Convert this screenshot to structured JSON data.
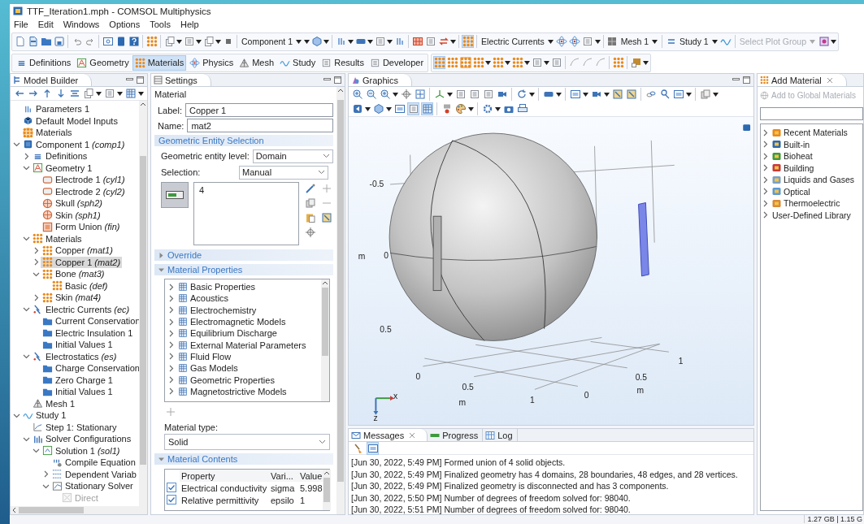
{
  "window": {
    "title": "TTF_Iteration1.mph - COMSOL Multiphysics"
  },
  "menu": [
    "File",
    "Edit",
    "Windows",
    "Options",
    "Tools",
    "Help"
  ],
  "toolbar": {
    "dropdowns": [
      {
        "label": "Component 1",
        "disabled": false
      },
      {
        "label": "Electric Currents",
        "disabled": false
      },
      {
        "label": "Mesh 1",
        "disabled": false
      },
      {
        "label": "Study 1",
        "disabled": false
      },
      {
        "label": "Select Plot Group",
        "disabled": true
      }
    ]
  },
  "ribbon_tabs": [
    {
      "label": "Definitions",
      "selected": false
    },
    {
      "label": "Geometry",
      "selected": false
    },
    {
      "label": "Materials",
      "selected": true
    },
    {
      "label": "Physics",
      "selected": false
    },
    {
      "label": "Mesh",
      "selected": false
    },
    {
      "label": "Study",
      "selected": false
    },
    {
      "label": "Results",
      "selected": false
    },
    {
      "label": "Developer",
      "selected": false
    }
  ],
  "model_builder": {
    "title": "Model Builder",
    "tree": [
      {
        "label": "Parameters 1",
        "kind": "parameter",
        "selected": false,
        "disabled": false
      },
      {
        "label": "Default Model Inputs",
        "kind": "inputs",
        "selected": false,
        "disabled": false
      },
      {
        "label": "Materials",
        "kind": "material-global",
        "selected": false,
        "disabled": false
      },
      {
        "label": "Component 1",
        "tag": "(comp1)",
        "kind": "component",
        "expanded": true,
        "selected": false,
        "disabled": false,
        "children": [
          {
            "label": "Definitions",
            "kind": "definitions",
            "expanded": false,
            "selected": false,
            "disabled": false
          },
          {
            "label": "Geometry 1",
            "kind": "geometry",
            "expanded": true,
            "selected": false,
            "disabled": false,
            "children": [
              {
                "label": "Electrode 1",
                "tag": "(cyl1)",
                "kind": "cylinder",
                "selected": false,
                "disabled": false
              },
              {
                "label": "Electrode 2",
                "tag": "(cyl2)",
                "kind": "cylinder",
                "selected": false,
                "disabled": false
              },
              {
                "label": "Skull",
                "tag": "(sph2)",
                "kind": "sphere",
                "selected": false,
                "disabled": false
              },
              {
                "label": "Skin",
                "tag": "(sph1)",
                "kind": "sphere",
                "selected": false,
                "disabled": false
              },
              {
                "label": "Form Union",
                "tag": "(fin)",
                "kind": "union",
                "selected": false,
                "disabled": false
              }
            ]
          },
          {
            "label": "Materials",
            "kind": "material",
            "expanded": true,
            "selected": false,
            "disabled": false,
            "children": [
              {
                "label": "Copper",
                "tag": "(mat1)",
                "kind": "material",
                "expanded": false,
                "selected": false,
                "disabled": false
              },
              {
                "label": "Copper 1",
                "tag": "(mat2)",
                "kind": "material",
                "expanded": false,
                "selected": true,
                "disabled": false
              },
              {
                "label": "Bone",
                "tag": "(mat3)",
                "kind": "material",
                "expanded": true,
                "selected": false,
                "disabled": false,
                "children": [
                  {
                    "label": "Basic",
                    "tag": "(def)",
                    "kind": "material",
                    "selected": false,
                    "disabled": false
                  }
                ]
              },
              {
                "label": "Skin",
                "tag": "(mat4)",
                "kind": "material",
                "expanded": false,
                "selected": false,
                "disabled": false
              }
            ]
          },
          {
            "label": "Electric Currents",
            "tag": "(ec)",
            "kind": "physics",
            "expanded": true,
            "selected": false,
            "disabled": false,
            "children": [
              {
                "label": "Current Conservation",
                "kind": "feature",
                "selected": false,
                "disabled": false
              },
              {
                "label": "Electric Insulation 1",
                "kind": "feature",
                "selected": false,
                "disabled": false
              },
              {
                "label": "Initial Values 1",
                "kind": "feature",
                "selected": false,
                "disabled": false
              }
            ]
          },
          {
            "label": "Electrostatics",
            "tag": "(es)",
            "kind": "physics",
            "expanded": true,
            "selected": false,
            "disabled": false,
            "children": [
              {
                "label": "Charge Conservation",
                "kind": "feature",
                "selected": false,
                "disabled": false
              },
              {
                "label": "Zero Charge 1",
                "kind": "feature",
                "selected": false,
                "disabled": false
              },
              {
                "label": "Initial Values 1",
                "kind": "feature",
                "selected": false,
                "disabled": false
              }
            ]
          },
          {
            "label": "Mesh 1",
            "kind": "mesh",
            "selected": false,
            "disabled": false
          }
        ]
      },
      {
        "label": "Study 1",
        "kind": "study",
        "expanded": true,
        "selected": false,
        "disabled": false,
        "children": [
          {
            "label": "Step 1: Stationary",
            "kind": "step",
            "selected": false,
            "disabled": false
          },
          {
            "label": "Solver Configurations",
            "kind": "solver",
            "expanded": true,
            "selected": false,
            "disabled": false,
            "children": [
              {
                "label": "Solution 1",
                "tag": "(sol1)",
                "kind": "solution",
                "expanded": true,
                "selected": false,
                "disabled": false,
                "children": [
                  {
                    "label": "Compile Equation",
                    "kind": "compile",
                    "selected": false,
                    "disabled": false
                  },
                  {
                    "label": "Dependent Variab",
                    "kind": "variables",
                    "expanded": false,
                    "selected": false,
                    "disabled": false
                  },
                  {
                    "label": "Stationary Solver",
                    "kind": "stationary",
                    "expanded": true,
                    "selected": false,
                    "disabled": false,
                    "children": [
                      {
                        "label": "Direct",
                        "kind": "direct",
                        "selected": false,
                        "disabled": true
                      }
                    ]
                  }
                ]
              }
            ]
          }
        ]
      }
    ]
  },
  "settings": {
    "title": "Settings",
    "heading": "Material",
    "label_field": {
      "label": "Label:",
      "value": "Copper 1"
    },
    "name_field": {
      "label": "Name:",
      "value": "mat2"
    },
    "entity_section": "Geometric Entity Selection",
    "entity_level": {
      "label": "Geometric entity level:",
      "value": "Domain"
    },
    "selection": {
      "label": "Selection:",
      "value": "Manual"
    },
    "selection_list": [
      "4"
    ],
    "override": {
      "title": "Override",
      "expanded": false
    },
    "properties": {
      "title": "Material Properties",
      "expanded": true,
      "items": [
        "Basic Properties",
        "Acoustics",
        "Electrochemistry",
        "Electromagnetic Models",
        "Equilibrium Discharge",
        "External Material Parameters",
        "Fluid Flow",
        "Gas Models",
        "Geometric Properties",
        "Magnetostrictive Models"
      ]
    },
    "material_type": {
      "label": "Material type:",
      "value": "Solid"
    },
    "contents": {
      "title": "Material Contents",
      "expanded": true,
      "columns": [
        "Property",
        "Vari...",
        "Value"
      ],
      "rows": [
        {
          "checked": true,
          "property": "Electrical conductivity",
          "variable": "sigma",
          "value": "5.998"
        },
        {
          "checked": true,
          "property": "Relative permittivity",
          "variable": "epsilo",
          "value": "1"
        }
      ]
    }
  },
  "graphics": {
    "title": "Graphics",
    "axis_labels": [
      "-0.5",
      "m",
      "0",
      "0.5",
      "1",
      "0",
      "0.5",
      "0.5",
      "m",
      "1",
      "0",
      "m",
      "x",
      "z"
    ]
  },
  "messages": {
    "tabs": [
      {
        "label": "Messages",
        "selected": true
      },
      {
        "label": "Progress",
        "selected": false
      },
      {
        "label": "Log",
        "selected": false
      }
    ],
    "lines": [
      "[Jun 30, 2022, 5:49 PM] Formed union of 4 solid objects.",
      "[Jun 30, 2022, 5:49 PM] Finalized geometry has 4 domains, 28 boundaries, 48 edges, and 28 vertices.",
      "[Jun 30, 2022, 5:49 PM] Finalized geometry is disconnected and has 3 components.",
      "[Jun 30, 2022, 5:50 PM] Number of degrees of freedom solved for: 98040.",
      "[Jun 30, 2022, 5:51 PM] Number of degrees of freedom solved for: 98040."
    ]
  },
  "add_material": {
    "title": "Add Material",
    "add_button": {
      "label": "Add to Global Materials",
      "disabled": true
    },
    "items": [
      "Recent Materials",
      "Built-in",
      "Bioheat",
      "Building",
      "Liquids and Gases",
      "Optical",
      "Thermoelectric",
      "User-Defined Library"
    ]
  },
  "status_bar": {
    "memory": "1.27 GB | 1.15 G"
  }
}
